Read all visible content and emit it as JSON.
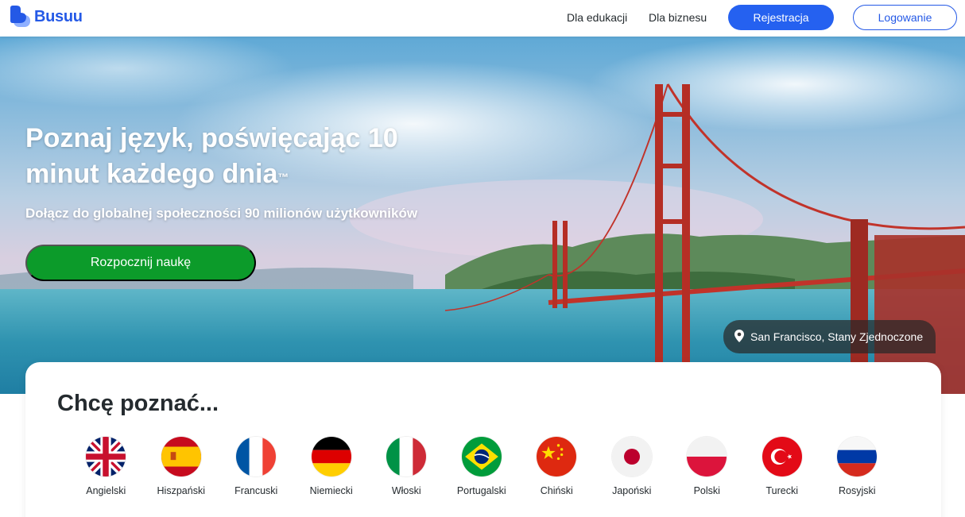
{
  "header": {
    "brand": "Busuu",
    "nav": [
      "Dla edukacji",
      "Dla biznesu"
    ],
    "register_label": "Rejestracja",
    "login_label": "Logowanie"
  },
  "hero": {
    "title": "Poznaj język, poświęcając 10 minut każdego dnia",
    "trademark": "™",
    "subtitle": "Dołącz do globalnej społeczności 90 milionów użytkowników",
    "cta_label": "Rozpocznij naukę",
    "location": "San Francisco, Stany Zjednoczone",
    "location_icon": "map-pin-icon"
  },
  "languages": {
    "heading": "Chcę poznać...",
    "items": [
      {
        "label": "Angielski",
        "icon": "uk-flag-icon"
      },
      {
        "label": "Hiszpański",
        "icon": "spain-flag-icon"
      },
      {
        "label": "Francuski",
        "icon": "france-flag-icon"
      },
      {
        "label": "Niemiecki",
        "icon": "germany-flag-icon"
      },
      {
        "label": "Włoski",
        "icon": "italy-flag-icon"
      },
      {
        "label": "Portugalski",
        "icon": "brazil-flag-icon"
      },
      {
        "label": "Chiński",
        "icon": "china-flag-icon"
      },
      {
        "label": "Japoński",
        "icon": "japan-flag-icon"
      },
      {
        "label": "Polski",
        "icon": "poland-flag-icon"
      },
      {
        "label": "Turecki",
        "icon": "turkey-flag-icon"
      },
      {
        "label": "Rosyjski",
        "icon": "russia-flag-icon"
      }
    ]
  },
  "colors": {
    "brand_blue": "#2459e6",
    "register_bg": "#2561f0",
    "cta_green": "#0c9b2a",
    "text_dark": "#252b2f"
  }
}
